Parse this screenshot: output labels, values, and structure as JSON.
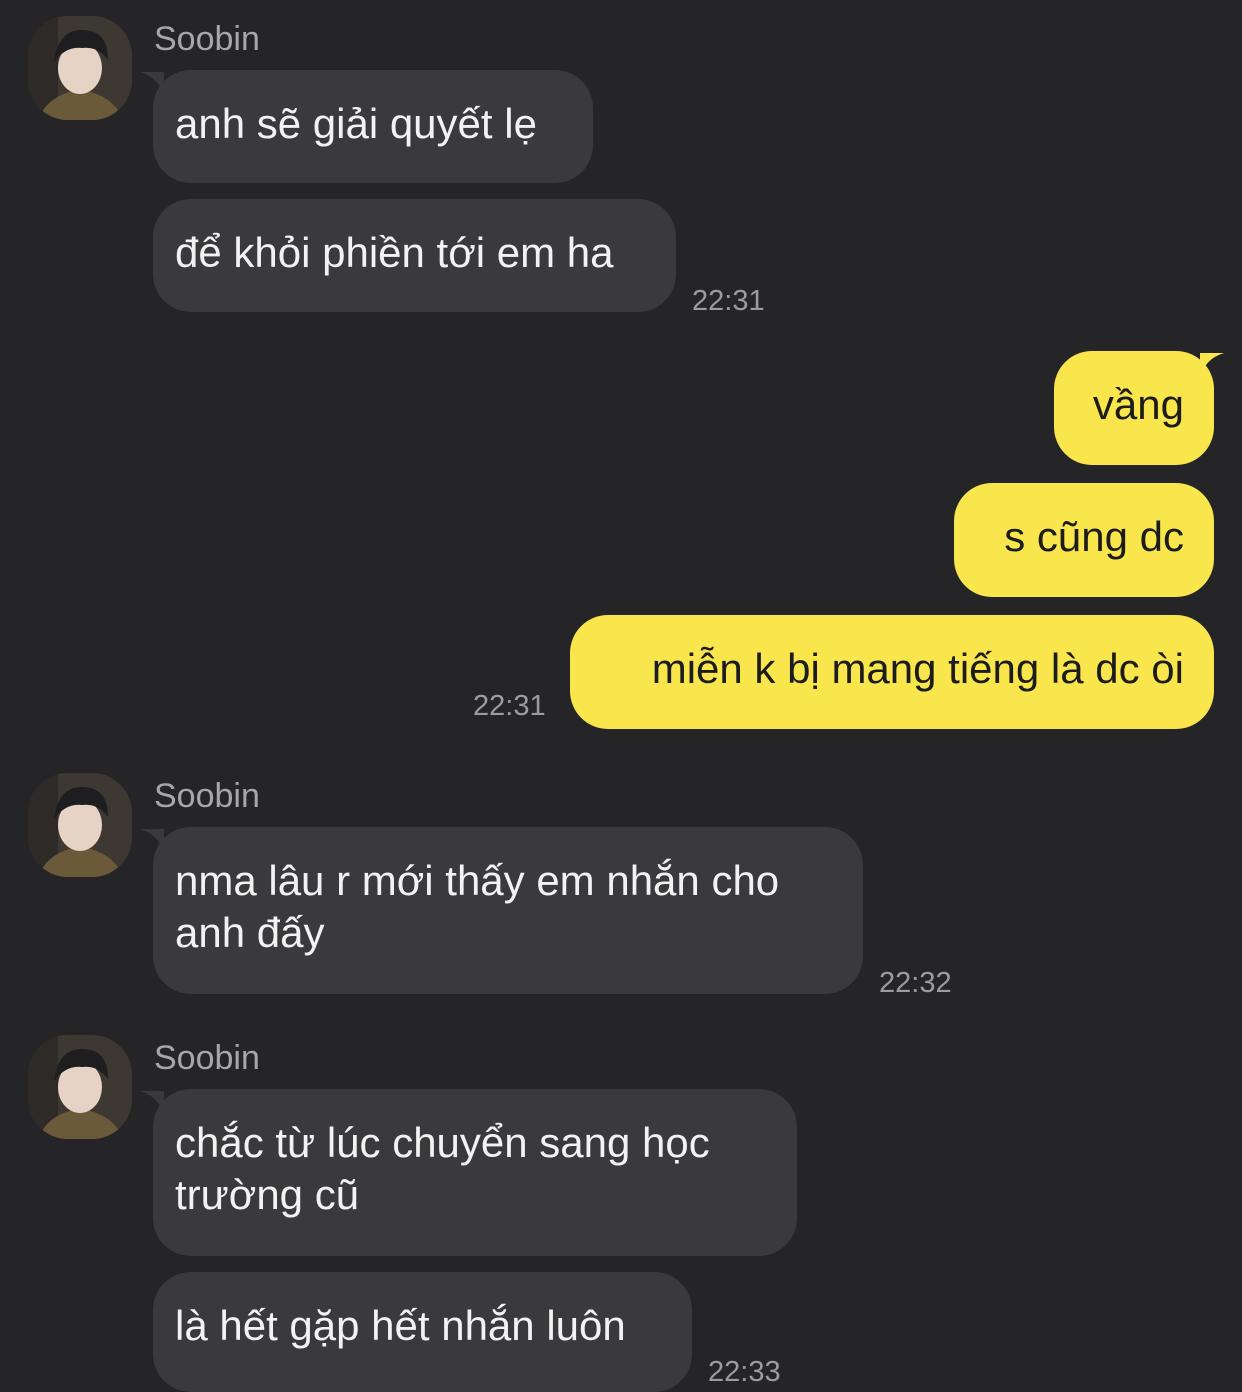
{
  "contact": {
    "name": "Soobin",
    "avatar_icon": "profile-photo"
  },
  "messages": [
    {
      "direction": "in",
      "sender": "Soobin",
      "text": "anh sẽ giải quyết lẹ"
    },
    {
      "direction": "in",
      "text": "để khỏi phiền tới em ha",
      "time": "22:31"
    },
    {
      "direction": "out",
      "text": "vầng"
    },
    {
      "direction": "out",
      "text": "s cũng dc"
    },
    {
      "direction": "out",
      "text": "miễn k bị mang tiếng là dc òi",
      "time": "22:31"
    },
    {
      "direction": "in",
      "sender": "Soobin",
      "text": "nma lâu r mới thấy em nhắn cho anh đấy",
      "time": "22:32"
    },
    {
      "direction": "in",
      "sender": "Soobin",
      "text": "chắc từ lúc chuyển sang học trường cũ"
    },
    {
      "direction": "in",
      "text": "là hết gặp hết nhắn luôn",
      "time": "22:33"
    }
  ],
  "colors": {
    "background": "#252527",
    "incoming_bubble": "#3a3a3d",
    "outgoing_bubble": "#f9e54c"
  }
}
